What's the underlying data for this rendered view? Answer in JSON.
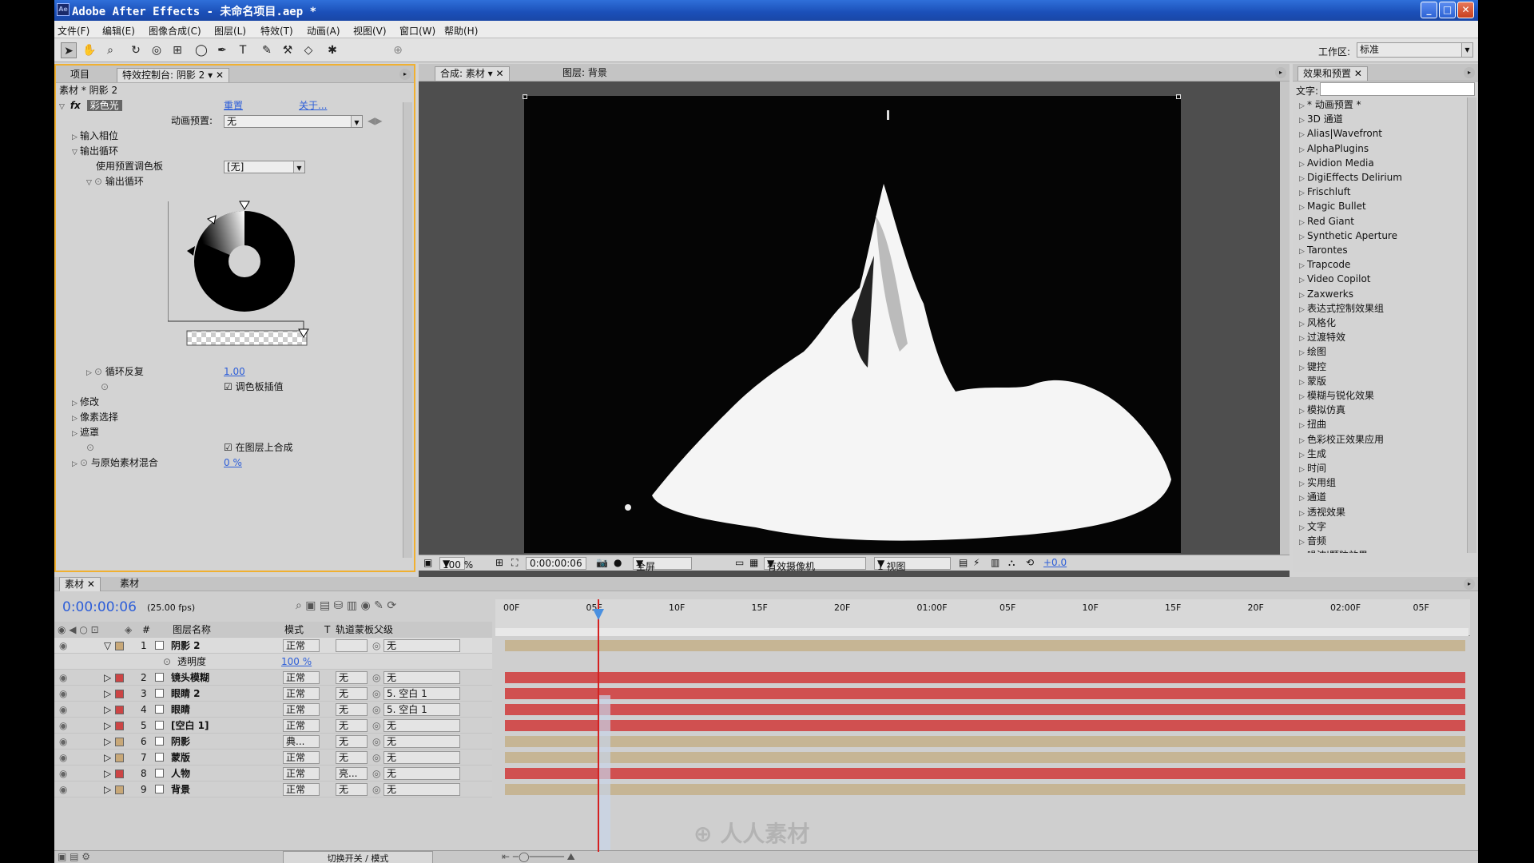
{
  "window": {
    "title": "Adobe After Effects - 未命名项目.aep *",
    "min": "_",
    "max": "□",
    "close": "✕"
  },
  "menu": [
    "文件(F)",
    "编辑(E)",
    "图像合成(C)",
    "图层(L)",
    "特效(T)",
    "动画(A)",
    "视图(V)",
    "窗口(W)",
    "帮助(H)"
  ],
  "toolbar": {
    "workspace_label": "工作区:",
    "workspace_value": "标准"
  },
  "effects_panel": {
    "tabs": [
      "项目",
      "特效控制台: 阴影 2"
    ],
    "breadcrumb": "素材 * 阴影 2",
    "effect_name": "彩色光",
    "reset": "重置",
    "about": "关于...",
    "anim_preset_label": "动画预置:",
    "anim_preset_value": "无",
    "input_phase": "输入相位",
    "output_cycle": "输出循环",
    "use_preset_palette_label": "使用预置调色板",
    "use_preset_palette_value": "[无]",
    "output_cycle_sub": "输出循环",
    "cycle_repeat_label": "循环反复",
    "cycle_repeat_value": "1.00",
    "palette_interp_label": "调色板插值",
    "modify": "修改",
    "pixel_select": "像素选择",
    "mask": "遮罩",
    "composite_on_layer_label": "在图层上合成",
    "blend_original_label": "与原始素材混合",
    "blend_original_value": "0 %"
  },
  "viewer": {
    "tabs": [
      "合成: 素材",
      "图层: 背景"
    ],
    "zoom": "100 %",
    "timecode": "0:00:00:06",
    "resolution": "全屏",
    "camera": "有效摄像机",
    "views": "1 视图",
    "exposure": "+0.0"
  },
  "fx_presets": {
    "tab": "效果和预置",
    "search_label": "文字:",
    "search_value": "",
    "items": [
      "* 动画预置 *",
      "3D 通道",
      "Alias|Wavefront",
      "AlphaPlugins",
      "Avidion Media",
      "DigiEffects Delirium",
      "Frischluft",
      "Magic Bullet",
      "Red Giant",
      "Synthetic Aperture",
      "Tarontes",
      "Trapcode",
      "Video Copilot",
      "Zaxwerks",
      "表达式控制效果组",
      "风格化",
      "过渡特效",
      "绘图",
      "键控",
      "蒙版",
      "模糊与锐化效果",
      "模拟仿真",
      "扭曲",
      "色彩校正效果应用",
      "生成",
      "时间",
      "实用组",
      "通道",
      "透视效果",
      "文字",
      "音频",
      "噪波|颗粒效果"
    ]
  },
  "timeline": {
    "tabs": [
      "素材",
      "素材"
    ],
    "timecode": "0:00:00:06",
    "fps": "(25.00 fps)",
    "headers": {
      "num": "#",
      "name": "图层名称",
      "mode": "模式",
      "t": "T",
      "trkmat": "轨道蒙板",
      "parent": "父级"
    },
    "ruler": [
      "00F",
      "05F",
      "10F",
      "15F",
      "20F",
      "01:00F",
      "05F",
      "10F",
      "15F",
      "20F",
      "02:00F",
      "05F"
    ],
    "opacity_label": "透明度",
    "opacity_value": "100 %",
    "footer_toggle": "切换开关 / 模式",
    "layers": [
      {
        "num": "1",
        "name": "阴影 2",
        "mode": "正常",
        "trk": "",
        "parent": "无",
        "label_color": "#c8a878",
        "bar": "tan"
      },
      {
        "num": "2",
        "name": "镜头模糊",
        "mode": "正常",
        "trk": "无",
        "parent": "无",
        "label_color": "#cc4444",
        "bar": "red"
      },
      {
        "num": "3",
        "name": "眼睛 2",
        "mode": "正常",
        "trk": "无",
        "parent": "5. 空白 1",
        "label_color": "#cc4444",
        "bar": "red"
      },
      {
        "num": "4",
        "name": "眼睛",
        "mode": "正常",
        "trk": "无",
        "parent": "5. 空白 1",
        "label_color": "#cc4444",
        "bar": "red"
      },
      {
        "num": "5",
        "name": "[空白 1]",
        "mode": "正常",
        "trk": "无",
        "parent": "无",
        "label_color": "#cc4444",
        "bar": "red"
      },
      {
        "num": "6",
        "name": "阴影",
        "mode": "典...",
        "trk": "无",
        "parent": "无",
        "label_color": "#c8a878",
        "bar": "tan"
      },
      {
        "num": "7",
        "name": "蒙版",
        "mode": "正常",
        "trk": "无",
        "parent": "无",
        "label_color": "#c8a878",
        "bar": "tan"
      },
      {
        "num": "8",
        "name": "人物",
        "mode": "正常",
        "trk": "亮...",
        "parent": "无",
        "label_color": "#cc4444",
        "bar": "red"
      },
      {
        "num": "9",
        "name": "背景",
        "mode": "正常",
        "trk": "无",
        "parent": "无",
        "label_color": "#c8a878",
        "bar": "tan"
      }
    ]
  },
  "watermark": "人人素材",
  "colors": {
    "accent": "#f0b030",
    "red_bar": "#d05050",
    "tan_bar": "#c6b594",
    "timecode": "#2d5ed8"
  }
}
